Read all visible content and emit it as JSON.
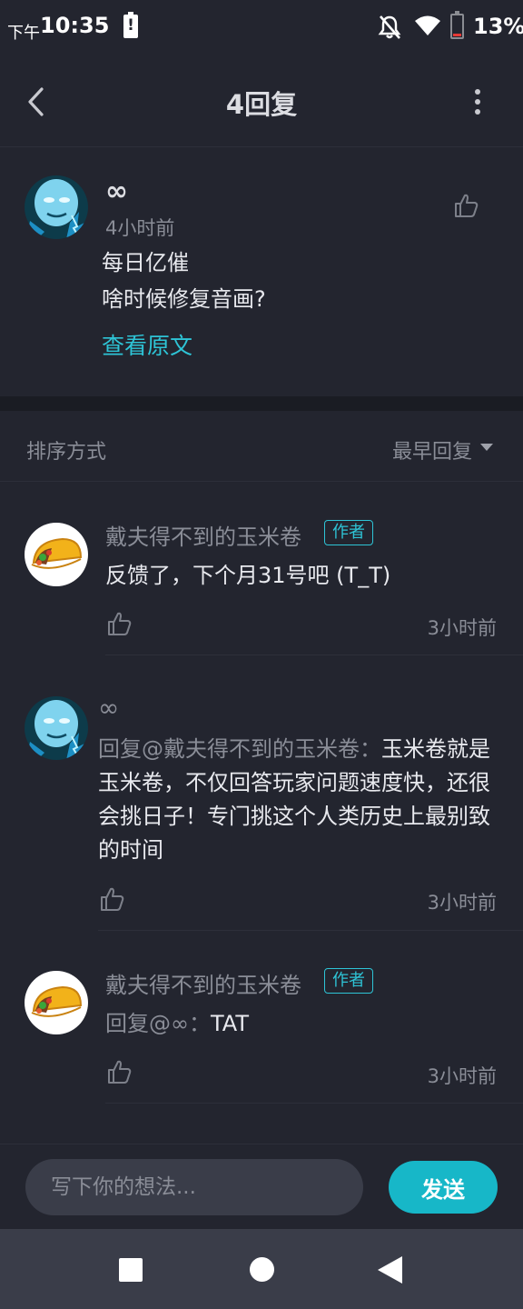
{
  "status_bar": {
    "time_prefix": "下午",
    "time": "10:35",
    "battery_alert": "!",
    "battery_percent": "13%",
    "battery_level_percent": 13
  },
  "header": {
    "title": "4回复"
  },
  "post": {
    "username": "∞",
    "time": "4小时前",
    "text_lines": [
      "每日亿催",
      "啥时候修复音画?"
    ],
    "view_original_label": "查看原文"
  },
  "sort": {
    "label": "排序方式",
    "value": "最早回复"
  },
  "replies": [
    {
      "name": "戴夫得不到的玉米卷",
      "badge": "作者",
      "text": "反馈了，下个月31号吧 (T_T)",
      "time": "3小时前"
    },
    {
      "name": "∞",
      "mention": "回复@戴夫得不到的玉米卷：",
      "text": "玉米卷就是玉米卷，不仅回答玩家问题速度快，还很会挑日子！专门挑这个人类历史上最别致的时间",
      "time": "3小时前"
    },
    {
      "name": "戴夫得不到的玉米卷",
      "badge": "作者",
      "mention": "回复@∞：",
      "text": "TAT",
      "time": "3小时前"
    }
  ],
  "input": {
    "placeholder": "写下你的想法...",
    "send_label": "发送"
  },
  "colors": {
    "background": "#23252f",
    "accent": "#2ec4d6",
    "send_button": "#17b7c8",
    "muted_text": "#8a8d97"
  },
  "icons": {
    "back": "chevron-left-icon",
    "more": "more-vertical-icon",
    "like": "thumbs-up-icon",
    "dnd": "bell-off-icon",
    "wifi": "wifi-icon"
  }
}
